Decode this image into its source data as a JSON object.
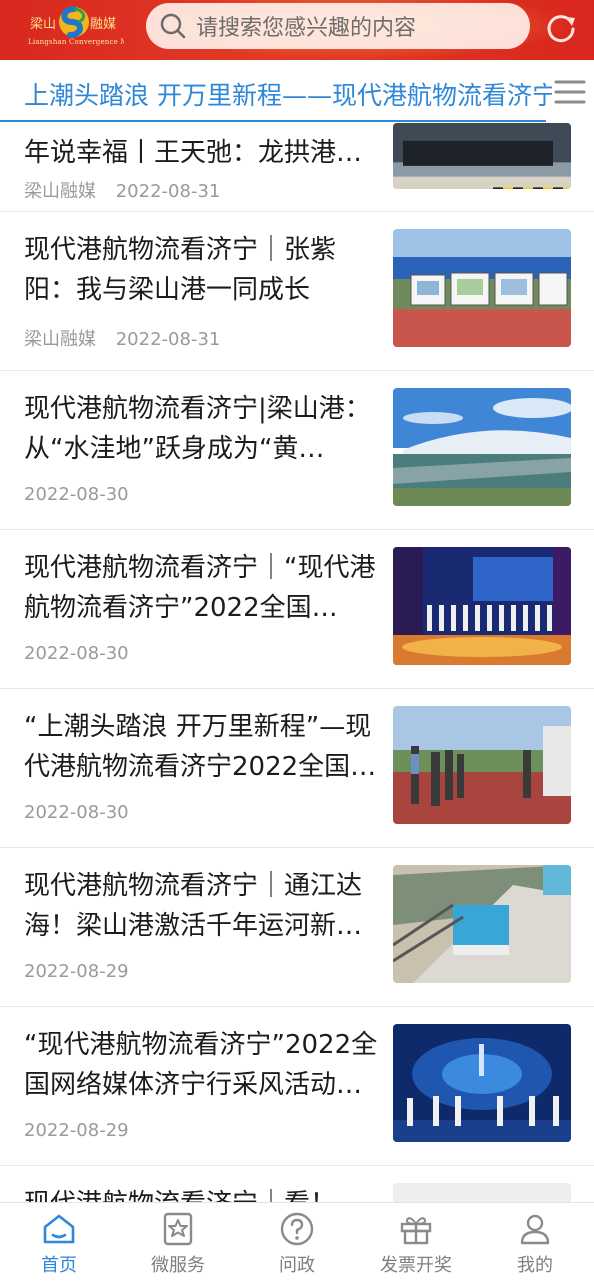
{
  "header": {
    "logo_text": "梁山融媒",
    "logo_subtitle": "Liangshan Convergence Media",
    "search_placeholder": "请搜索您感兴趣的内容"
  },
  "topic": {
    "title": "上潮头踏浪 开万里新程——现代港航物流看济宁"
  },
  "news": [
    {
      "title": "年说幸福丨王天弛：龙拱港…",
      "source": "梁山融媒",
      "date": "2022-08-31",
      "image": "port-cargo-photo"
    },
    {
      "title": "现代港航物流看济宁｜张紫阳：我与梁山港一同成长",
      "source": "梁山融媒",
      "date": "2022-08-31",
      "image": "exhibition-boards-photo"
    },
    {
      "title": "现代港航物流看济宁|梁山港：从“水洼地”跃身成为“黄…",
      "source": "",
      "date": "2022-08-30",
      "image": "port-aerial-photo"
    },
    {
      "title": "现代港航物流看济宁｜“现代港航物流看济宁”2022全国…",
      "source": "",
      "date": "2022-08-30",
      "image": "stage-ceremony-photo"
    },
    {
      "title": "“上潮头踏浪 开万里新程”—现代港航物流看济宁2022全国…",
      "source": "",
      "date": "2022-08-30",
      "image": "visitors-photo"
    },
    {
      "title": "现代港航物流看济宁｜通江达海！梁山港激活千年运河新…",
      "source": "",
      "date": "2022-08-29",
      "image": "rail-yard-aerial-photo"
    },
    {
      "title": "“现代港航物流看济宁”2022全国网络媒体济宁行采风活动…",
      "source": "",
      "date": "2022-08-29",
      "image": "launch-stage-photo"
    },
    {
      "title": "现代港航物流看济宁｜看！济…",
      "source": "",
      "date": "",
      "image": "loading-placeholder"
    }
  ],
  "bottom_nav": [
    {
      "label": "首页",
      "icon": "home-icon",
      "active": true
    },
    {
      "label": "微服务",
      "icon": "star-card-icon",
      "active": false
    },
    {
      "label": "问政",
      "icon": "question-icon",
      "active": false
    },
    {
      "label": "发票开奖",
      "icon": "gift-icon",
      "active": false
    },
    {
      "label": "我的",
      "icon": "user-icon",
      "active": false
    }
  ],
  "colors": {
    "header_red": "#d8281f",
    "accent_blue": "#2f87d8",
    "meta_gray": "#9a9a9a"
  }
}
